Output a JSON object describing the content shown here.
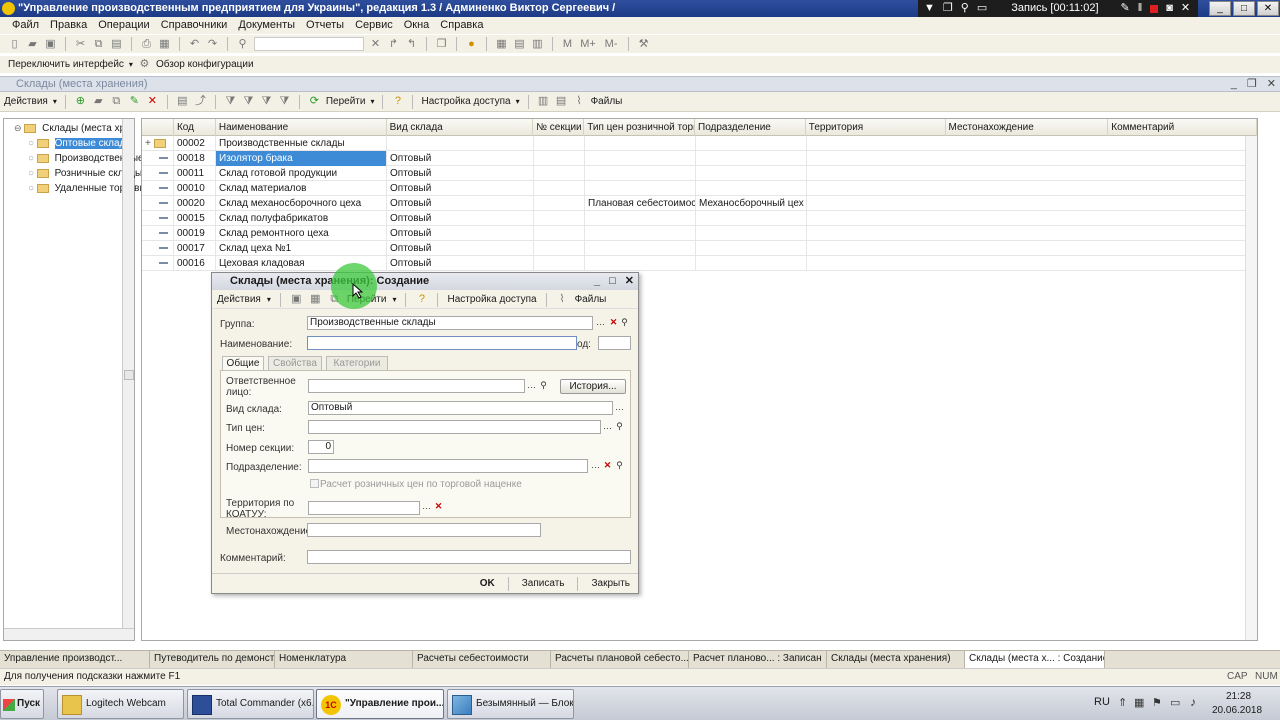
{
  "app": {
    "title": "\"Управление производственным предприятием для Украины\", редакция 1.3 / Админенко Виктор Сергеевич /"
  },
  "recorder": {
    "label": "Запись [00:11:02]"
  },
  "menu": [
    "Файл",
    "Правка",
    "Операции",
    "Справочники",
    "Документы",
    "Отчеты",
    "Сервис",
    "Окна",
    "Справка"
  ],
  "toolbar2": {
    "switch_interface": "Переключить интерфейс",
    "config_overview": "Обзор конфигурации"
  },
  "list_window": {
    "title": "Склады (места хранения)",
    "toolbar": {
      "actions": "Действия",
      "goto": "Перейти",
      "access": "Настройка доступа",
      "files": "Файлы"
    }
  },
  "tree": {
    "items": [
      {
        "label": "Склады (места хранения)"
      },
      {
        "label": "Оптовые склады"
      },
      {
        "label": "Производственные склады"
      },
      {
        "label": "Розничные склады"
      },
      {
        "label": "Удаленные торговые точки"
      }
    ]
  },
  "table": {
    "columns": [
      "Код",
      "Наименование",
      "Вид склада",
      "№ секции",
      "Тип цен розничной торг...",
      "Подразделение",
      "Территория",
      "Местонахождение",
      "Комментарий"
    ],
    "rows": [
      {
        "code": "00002",
        "name": "Производственные склады",
        "kind": "",
        "section": "",
        "price": "",
        "dept": "",
        "group": true
      },
      {
        "code": "00018",
        "name": "Изолятор брака",
        "kind": "Оптовый",
        "section": "",
        "price": "",
        "dept": "",
        "selected": true
      },
      {
        "code": "00011",
        "name": "Склад готовой продукции",
        "kind": "Оптовый",
        "section": "",
        "price": "",
        "dept": ""
      },
      {
        "code": "00010",
        "name": "Склад материалов",
        "kind": "Оптовый",
        "section": "",
        "price": "",
        "dept": ""
      },
      {
        "code": "00020",
        "name": "Склад механосборочного цеха",
        "kind": "Оптовый",
        "section": "",
        "price": "Плановая себестоимос...",
        "dept": "Механосборочный цех"
      },
      {
        "code": "00015",
        "name": "Склад полуфабрикатов",
        "kind": "Оптовый",
        "section": "",
        "price": "",
        "dept": ""
      },
      {
        "code": "00019",
        "name": "Склад ремонтного цеха",
        "kind": "Оптовый",
        "section": "",
        "price": "",
        "dept": ""
      },
      {
        "code": "00017",
        "name": "Склад цеха №1",
        "kind": "Оптовый",
        "section": "",
        "price": "",
        "dept": ""
      },
      {
        "code": "00016",
        "name": "Цеховая кладовая",
        "kind": "Оптовый",
        "section": "",
        "price": "",
        "dept": ""
      }
    ]
  },
  "dialog": {
    "title": "Склады (места хранения): Создание",
    "toolbar": {
      "actions": "Действия",
      "goto": "Перейти",
      "access": "Настройка доступа",
      "files": "Файлы"
    },
    "group_label": "Группа:",
    "group_value": "Производственные склады",
    "name_label": "Наименование:",
    "name_value": "",
    "code_label": "од:",
    "tabs": [
      "Общие",
      "Свойства",
      "Категории"
    ],
    "responsible_label": "Ответственное лицо:",
    "history_button": "История...",
    "kind_label": "Вид склада:",
    "kind_value": "Оптовый",
    "price_label": "Тип цен:",
    "section_label": "Номер секции:",
    "section_value": "0",
    "dept_label": "Подразделение:",
    "retail_checkbox": "Расчет розничных цен по торговой наценке",
    "territory_label": "Территория по КОАТУУ:",
    "location_label": "Местонахождение:",
    "comment_label": "Комментарий:",
    "ok": "OK",
    "save": "Записать",
    "close": "Закрыть"
  },
  "window_tabs": [
    {
      "label": "Управление производст..."
    },
    {
      "label": "Путеводитель по демонстр..."
    },
    {
      "label": "Номенклатура"
    },
    {
      "label": "Расчеты себестоимости"
    },
    {
      "label": "Расчеты плановой себесто..."
    },
    {
      "label": "Расчет планово... : Записан"
    },
    {
      "label": "Склады (места хранения)"
    },
    {
      "label": "Склады (места х... : Создание",
      "active": true
    }
  ],
  "status": {
    "hint": "Для получения подсказки нажмите F1",
    "cap": "CAP",
    "num": "NUM"
  },
  "taskbar": {
    "start": "Пуск",
    "buttons": [
      {
        "label": "Logitech Webcam"
      },
      {
        "label": "Total Commander (x6..."
      },
      {
        "label": "\"Управление прои..."
      },
      {
        "label": "Безымянный — Блок..."
      }
    ],
    "lang": "RU",
    "time": "21:28",
    "date": "20.06.2018"
  }
}
